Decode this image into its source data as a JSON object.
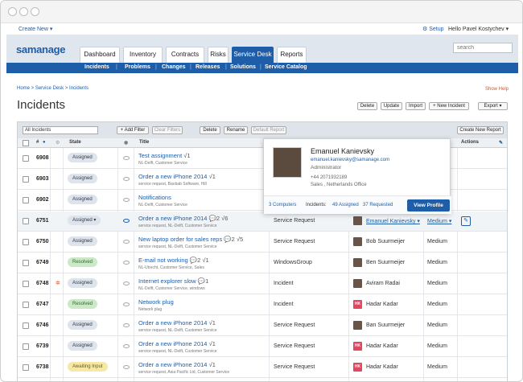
{
  "topbar": {
    "create": "Create New ▾",
    "setup": "⚙ Setup",
    "user": "Hello Pavel Kostychev ▾"
  },
  "logo": "samanage",
  "tabs": [
    {
      "label": "Dashboard"
    },
    {
      "label": "Inventory"
    },
    {
      "label": "Contracts"
    },
    {
      "label": "Risks"
    },
    {
      "label": "Service Desk"
    },
    {
      "label": "Reports"
    }
  ],
  "search": {
    "placeholder": "search"
  },
  "subnav": [
    "Incidents",
    "Problems",
    "Changes",
    "Releases",
    "Solutions",
    "Service Catalog"
  ],
  "breadcrumb": "Home > Service Desk > Incidents",
  "show_help": "Show Help",
  "page_title": "Incidents",
  "actions": {
    "delete": "Delete",
    "update": "Update",
    "import": "Import",
    "new": "+ New Incident",
    "export": "Export ▾"
  },
  "toolbar": {
    "filter": "All Incidents",
    "add_filter": "+ Add Filter",
    "clear": "Clear Filters",
    "delete": "Delete",
    "rename": "Rename",
    "default": "Default Report",
    "create": "Create New Report"
  },
  "columns": {
    "num": "#",
    "state": "State",
    "title": "Title",
    "actions": "Actions"
  },
  "rows": [
    {
      "num": "6908",
      "state": "Assigned",
      "title": "Test assignment",
      "count": "1",
      "sub": "NL-Delft, Customer Service"
    },
    {
      "num": "6903",
      "state": "Assigned",
      "title": "Order a new iPhone 2014",
      "count": "1",
      "sub": "service request, Baobab Software, Hill"
    },
    {
      "num": "6902",
      "state": "Assigned",
      "title": "Notifications",
      "sub": "NL-Delft, Customer Service"
    },
    {
      "num": "6751",
      "state": "Assigned ▾",
      "title": "Order a new iPhone 2014",
      "count": "2 √6",
      "sub": "service request, NL-Delft, Customer Service",
      "cat": "Service Request",
      "assignee": "Emanuel Kanievsky ▾",
      "priority": "Medium ▾"
    },
    {
      "num": "6750",
      "state": "Assigned",
      "title": "New laptop order for sales reps",
      "count": "2 √5",
      "sub": "service request, NL-Delft, Customer Service",
      "cat": "Service Request",
      "assignee": "Bob Suurmeijer",
      "priority": "Medium"
    },
    {
      "num": "6749",
      "state": "Resolved",
      "title": "E-mail not working",
      "count": "2 √1",
      "sub": "NL-Utrecht, Customer Service, Sales",
      "cat": "WindowsGroup",
      "assignee": "Ben Suurmeijer",
      "priority": "Medium"
    },
    {
      "num": "6748",
      "state": "Assigned",
      "title": "Internet explorer slow",
      "count": "1",
      "sub": "NL-Delft, Customer Service, windows",
      "cat": "Incident",
      "assignee": "Aviram Radai",
      "priority": "Medium"
    },
    {
      "num": "6747",
      "state": "Resolved",
      "title": "Network plug",
      "sub": "Network plug",
      "cat": "Incident",
      "assignee": "Hadar Kadar",
      "priority": "Medium"
    },
    {
      "num": "6746",
      "state": "Assigned",
      "title": "Order a new iPhone 2014",
      "count": "1",
      "sub": "service request, NL-Delft, Customer Service",
      "cat": "Service Request",
      "assignee": "Ban Suurmeijer",
      "priority": "Medium"
    },
    {
      "num": "6739",
      "state": "Assigned",
      "title": "Order a new iPhone 2014",
      "count": "1",
      "sub": "service request, NL-Delft, Customer Service",
      "cat": "Service Request",
      "assignee": "Hadar Kadar",
      "priority": "Medium"
    },
    {
      "num": "6738",
      "state": "Awaiting Input",
      "title": "Order a new iPhone 2014",
      "count": "1",
      "sub": "service request, Asia Pacific Ltd, Customer Service",
      "cat": "Service Request",
      "assignee": "Hadar Kadar",
      "priority": "Medium"
    }
  ],
  "popup": {
    "name": "Emanuel Kanievsky",
    "email": "emanuel.kanievsky@samanage.com",
    "role": "Administrator",
    "phone": "+44 2071932189",
    "location": "Sales , Netherlands Office",
    "computers": "3 Computers",
    "incidents_label": "Incidents:",
    "assigned": "49 Assigned",
    "requested": "37 Requested",
    "view_profile": "View Profile"
  },
  "avatar_initials": "HK"
}
